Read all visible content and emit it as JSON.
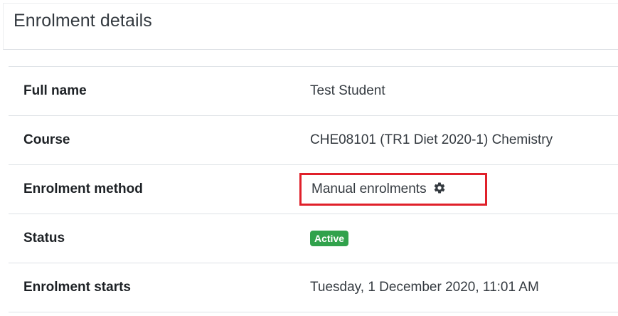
{
  "dialog": {
    "title": "Enrolment details"
  },
  "details": [
    {
      "label": "Full name",
      "value": "Test Student"
    },
    {
      "label": "Course",
      "value": "CHE08101 (TR1 Diet 2020-1) Chemistry"
    },
    {
      "label": "Enrolment method",
      "value": "Manual enrolments",
      "icon": "gear-icon",
      "highlight_color": "#e0202a"
    },
    {
      "label": "Status",
      "value": "Active",
      "badge_color": "#31a24c"
    },
    {
      "label": "Enrolment starts",
      "value": "Tuesday, 1 December 2020, 11:01 AM"
    }
  ]
}
